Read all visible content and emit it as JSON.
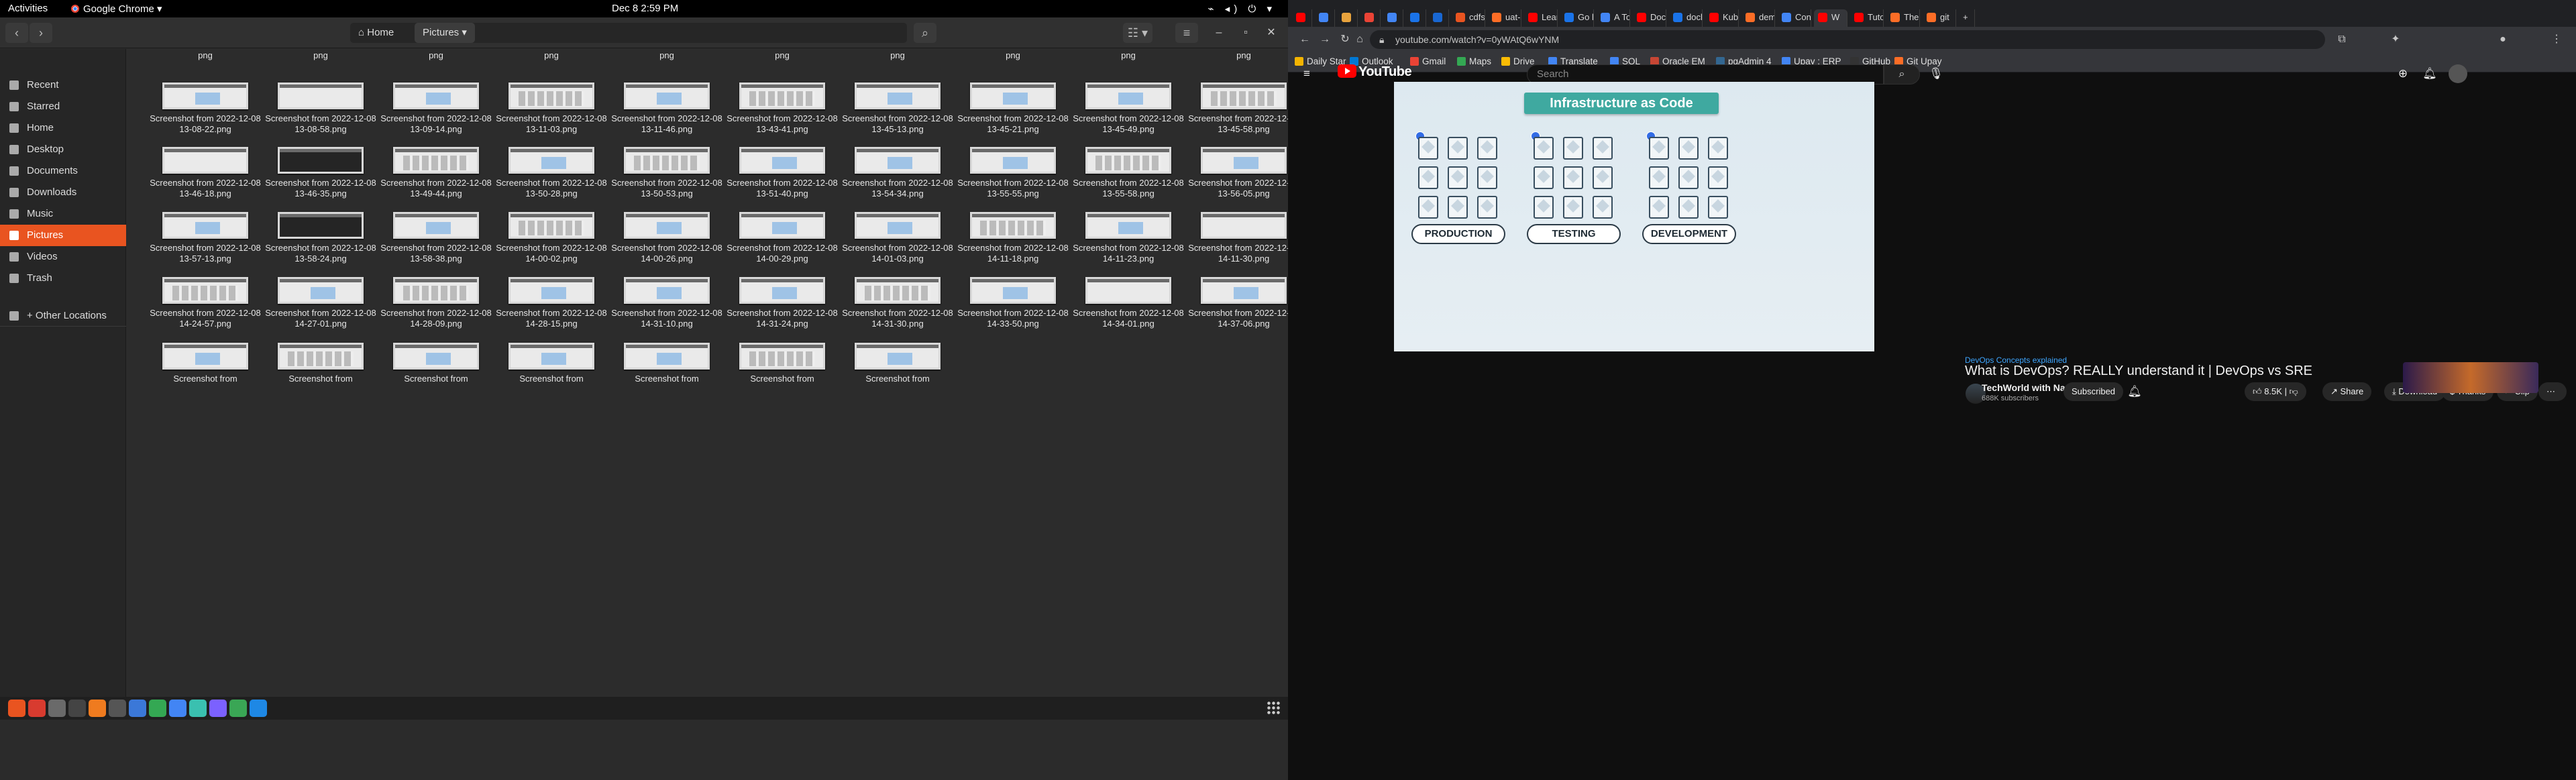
{
  "topbar": {
    "activities": "Activities",
    "app_menu": "Google Chrome ▾",
    "clock": "Dec 8  2:59 PM",
    "system_icons": "⌁ ◂) ⏻ ▾"
  },
  "files": {
    "path": {
      "home": "Home",
      "current": "Pictures"
    },
    "sidebar": [
      {
        "label": "Recent"
      },
      {
        "label": "Starred"
      },
      {
        "label": "Home"
      },
      {
        "label": "Desktop"
      },
      {
        "label": "Documents"
      },
      {
        "label": "Downloads"
      },
      {
        "label": "Music"
      },
      {
        "label": "Pictures"
      },
      {
        "label": "Videos"
      },
      {
        "label": "Trash"
      },
      {
        "label": "+ Other Locations"
      }
    ],
    "top_row_suffix": "png",
    "rows": [
      [
        "Screenshot from 2022-12-08 13-08-22.png",
        "Screenshot from 2022-12-08 13-08-58.png",
        "Screenshot from 2022-12-08 13-09-14.png",
        "Screenshot from 2022-12-08 13-11-03.png",
        "Screenshot from 2022-12-08 13-11-46.png",
        "Screenshot from 2022-12-08 13-43-41.png",
        "Screenshot from 2022-12-08 13-45-13.png",
        "Screenshot from 2022-12-08 13-45-21.png",
        "Screenshot from 2022-12-08 13-45-49.png",
        "Screenshot from 2022-12-08 13-45-58.png"
      ],
      [
        "Screenshot from 2022-12-08 13-46-18.png",
        "Screenshot from 2022-12-08 13-46-35.png",
        "Screenshot from 2022-12-08 13-49-44.png",
        "Screenshot from 2022-12-08 13-50-28.png",
        "Screenshot from 2022-12-08 13-50-53.png",
        "Screenshot from 2022-12-08 13-51-40.png",
        "Screenshot from 2022-12-08 13-54-34.png",
        "Screenshot from 2022-12-08 13-55-55.png",
        "Screenshot from 2022-12-08 13-55-58.png",
        "Screenshot from 2022-12-08 13-56-05.png"
      ],
      [
        "Screenshot from 2022-12-08 13-57-13.png",
        "Screenshot from 2022-12-08 13-58-24.png",
        "Screenshot from 2022-12-08 13-58-38.png",
        "Screenshot from 2022-12-08 14-00-02.png",
        "Screenshot from 2022-12-08 14-00-26.png",
        "Screenshot from 2022-12-08 14-00-29.png",
        "Screenshot from 2022-12-08 14-01-03.png",
        "Screenshot from 2022-12-08 14-11-18.png",
        "Screenshot from 2022-12-08 14-11-23.png",
        "Screenshot from 2022-12-08 14-11-30.png"
      ],
      [
        "Screenshot from 2022-12-08 14-24-57.png",
        "Screenshot from 2022-12-08 14-27-01.png",
        "Screenshot from 2022-12-08 14-28-09.png",
        "Screenshot from 2022-12-08 14-28-15.png",
        "Screenshot from 2022-12-08 14-31-10.png",
        "Screenshot from 2022-12-08 14-31-24.png",
        "Screenshot from 2022-12-08 14-31-30.png",
        "Screenshot from 2022-12-08 14-33-50.png",
        "Screenshot from 2022-12-08 14-34-01.png",
        "Screenshot from 2022-12-08 14-37-06.png"
      ],
      [
        "Screenshot from",
        "Screenshot from",
        "Screenshot from",
        "Screenshot from",
        "Screenshot from",
        "Screenshot from",
        "Screenshot from"
      ]
    ]
  },
  "chrome": {
    "tabs": [
      {
        "label": "",
        "color": "#ff0000"
      },
      {
        "label": "",
        "color": "#4285f4"
      },
      {
        "label": "",
        "color": "#e8a33d"
      },
      {
        "label": "",
        "color": "#ea4335"
      },
      {
        "label": "",
        "color": "#4285f4"
      },
      {
        "label": "",
        "color": "#1a73e8"
      },
      {
        "label": "",
        "color": "#1967d2"
      },
      {
        "label": "cdfs",
        "color": "#e95420"
      },
      {
        "label": "uat-s",
        "color": "#fc6d26"
      },
      {
        "label": "Lear",
        "color": "#ff0000"
      },
      {
        "label": "Go b",
        "color": "#1a73e8"
      },
      {
        "label": "A To",
        "color": "#4285f4"
      },
      {
        "label": "Doci",
        "color": "#ff0000"
      },
      {
        "label": "docl",
        "color": "#1a73e8"
      },
      {
        "label": "Kube",
        "color": "#ff0000"
      },
      {
        "label": "dem",
        "color": "#fc6d26"
      },
      {
        "label": "Conf",
        "color": "#4285f4"
      },
      {
        "label": "W",
        "color": "#ff0000"
      },
      {
        "label": "Tuto",
        "color": "#ff0000"
      },
      {
        "label": "The",
        "color": "#fc6d26"
      },
      {
        "label": "git",
        "color": "#fc6d26"
      }
    ],
    "url": "youtube.com/watch?v=0yWAtQ6wYNM",
    "bookmarks": [
      {
        "label": "Daily Star",
        "color": "#f4b400"
      },
      {
        "label": "Outlook",
        "color": "#0078d4"
      },
      {
        "label": "Gmail",
        "color": "#ea4335"
      },
      {
        "label": "Maps",
        "color": "#34a853"
      },
      {
        "label": "Drive",
        "color": "#fbbc04"
      },
      {
        "label": "Translate",
        "color": "#4285f4"
      },
      {
        "label": "SQL",
        "color": "#4285f4"
      },
      {
        "label": "Oracle EM",
        "color": "#c74634"
      },
      {
        "label": "pgAdmin 4",
        "color": "#336791"
      },
      {
        "label": "Upay : ERP",
        "color": "#4285f4"
      },
      {
        "label": "GitHub",
        "color": "#333333"
      },
      {
        "label": "Git Upay",
        "color": "#fc6d26"
      }
    ]
  },
  "youtube": {
    "logo": "YouTube",
    "search_placeholder": "Search",
    "slide": {
      "title": "Infrastructure as Code",
      "labels": [
        "PRODUCTION",
        "TESTING",
        "DEVELOPMENT"
      ]
    },
    "chip": "DevOps Concepts explained",
    "video_title": "What is DevOps? REALLY understand it | DevOps vs SRE",
    "channel": "TechWorld with Nana",
    "subscribers": "688K subscribers",
    "subscribed_label": "Subscribed",
    "likes": "8.5K",
    "share_label": "Share",
    "download_label": "Download",
    "thanks_label": "Thanks",
    "clip_label": "Clip"
  }
}
